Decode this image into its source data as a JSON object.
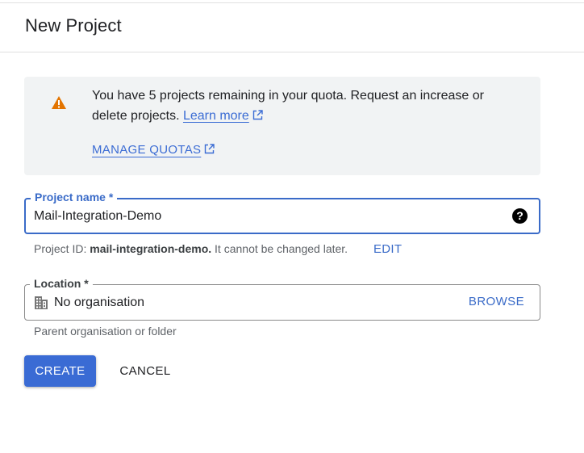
{
  "dialog": {
    "title": "New Project"
  },
  "notice": {
    "icon": "warning-icon",
    "icon_color": "#e37400",
    "text": "You have 5 projects remaining in your quota. Request an increase or delete projects. ",
    "learn_more": "Learn more",
    "manage_quotas": "MANAGE QUOTAS"
  },
  "project_name": {
    "label": "Project name *",
    "value": "Mail-Integration-Demo",
    "help_icon": "?"
  },
  "project_id": {
    "prefix": "Project ID: ",
    "id": "mail-integration-demo.",
    "suffix": " It cannot be changed later.",
    "edit": "EDIT"
  },
  "location": {
    "label": "Location *",
    "icon": "building-icon",
    "value": "No organisation",
    "browse": "BROWSE",
    "hint": "Parent organisation or folder"
  },
  "actions": {
    "create": "CREATE",
    "cancel": "CANCEL"
  },
  "colors": {
    "accent": "#3a6bd4",
    "notice_bg": "#f1f3f4",
    "warning": "#e37400"
  }
}
